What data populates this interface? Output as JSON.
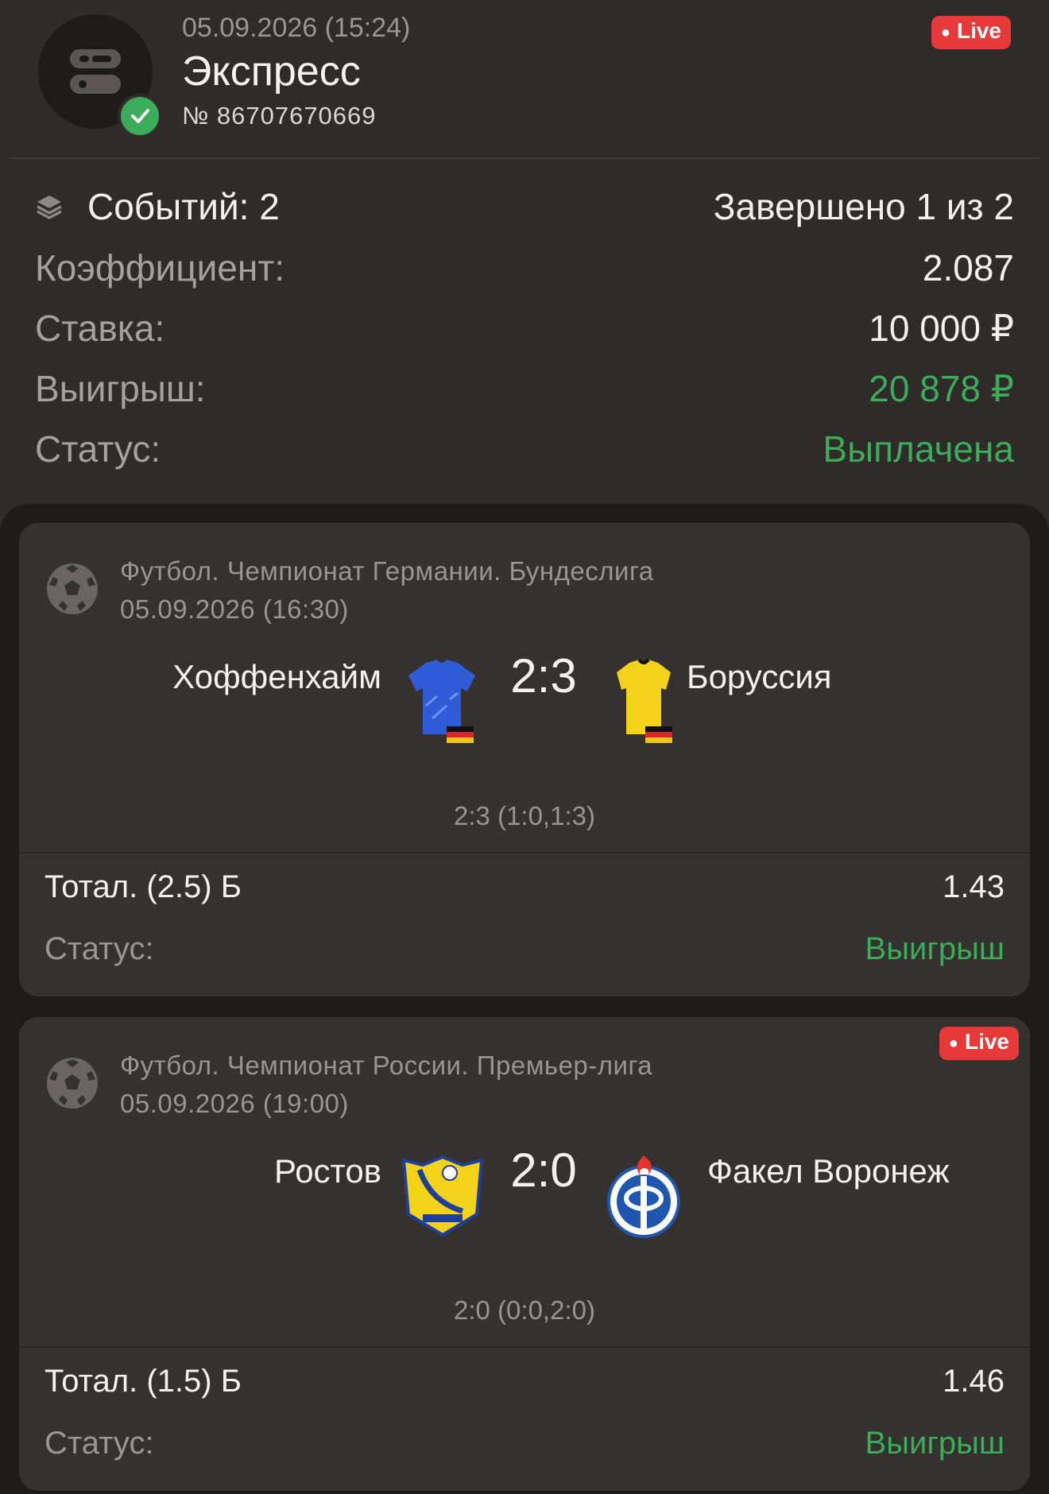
{
  "header": {
    "datetime": "05.09.2026 (15:24)",
    "title": "Экспресс",
    "number": "№ 86707670669",
    "live_badge": "Live",
    "bet_icon": "bet-slip-icon",
    "status_icon": "check-icon"
  },
  "summary": {
    "events_label": "Событий: 2",
    "events_icon": "layers-icon",
    "completed": "Завершено 1 из 2",
    "coef_label": "Коэффициент:",
    "coef_value": "2.087",
    "stake_label": "Ставка:",
    "stake_value": "10 000 ₽",
    "win_label": "Выигрыш:",
    "win_value": "20 878 ₽",
    "status_label": "Статус:",
    "status_value": "Выплачена"
  },
  "events": [
    {
      "sport_icon": "soccer-ball-icon",
      "league": "Футбол. Чемпионат Германии. Бундеслига",
      "datetime": "05.09.2026 (16:30)",
      "home": "Хоффенхайм",
      "away": "Боруссия",
      "home_logo": "blue-jersey-icon",
      "away_logo": "yellow-jersey-icon",
      "score": "2:3",
      "score_detail": "2:3 (1:0,1:3)",
      "market": "Тотал. (2.5) Б",
      "odd": "1.43",
      "status_label": "Статус:",
      "status_value": "Выигрыш"
    },
    {
      "sport_icon": "soccer-ball-icon",
      "league": "Футбол. Чемпионат России. Премьер-лига",
      "datetime": "05.09.2026 (19:00)",
      "home": "Ростов",
      "away": "Факел Воронеж",
      "home_logo": "rostov-crest-icon",
      "away_logo": "fakel-crest-icon",
      "live_badge": "Live",
      "score": "2:0",
      "score_detail": "2:0 (0:0,2:0)",
      "market": "Тотал. (1.5) Б",
      "odd": "1.46",
      "status_label": "Статус:",
      "status_value": "Выигрыш"
    }
  ],
  "colors": {
    "background": "#2f2b29",
    "sheet": "#1d1b1a",
    "card": "#35312f",
    "accent_green": "#3cab5c",
    "live_red": "#e7383a"
  }
}
